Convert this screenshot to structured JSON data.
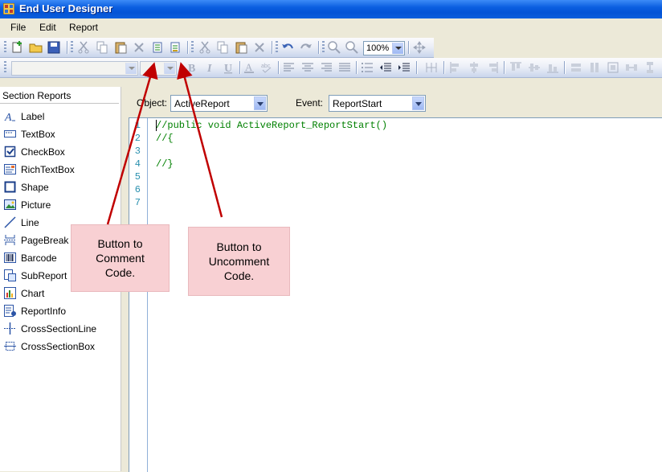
{
  "window": {
    "title": "End User Designer"
  },
  "menu": {
    "items": [
      "File",
      "Edit",
      "Report"
    ]
  },
  "toolbar1": {
    "zoom_value": "100%"
  },
  "toolbox": {
    "header": "Section Reports",
    "items": [
      {
        "label": "Label",
        "icon": "label-icon"
      },
      {
        "label": "TextBox",
        "icon": "textbox-icon"
      },
      {
        "label": "CheckBox",
        "icon": "checkbox-icon"
      },
      {
        "label": "RichTextBox",
        "icon": "richtextbox-icon"
      },
      {
        "label": "Shape",
        "icon": "shape-icon"
      },
      {
        "label": "Picture",
        "icon": "picture-icon"
      },
      {
        "label": "Line",
        "icon": "line-icon"
      },
      {
        "label": "PageBreak",
        "icon": "pagebreak-icon"
      },
      {
        "label": "Barcode",
        "icon": "barcode-icon"
      },
      {
        "label": "SubReport",
        "icon": "subreport-icon"
      },
      {
        "label": "Chart",
        "icon": "chart-icon"
      },
      {
        "label": "ReportInfo",
        "icon": "reportinfo-icon"
      },
      {
        "label": "CrossSectionLine",
        "icon": "crosssectionline-icon"
      },
      {
        "label": "CrossSectionBox",
        "icon": "crosssectionbox-icon"
      }
    ]
  },
  "script_editor": {
    "object_label": "Object:",
    "object_value": "ActiveReport",
    "event_label": "Event:",
    "event_value": "ReportStart",
    "line_numbers": [
      "1",
      "2",
      "3",
      "4",
      "5",
      "6",
      "7"
    ],
    "code_lines": [
      "//public void ActiveReport_ReportStart()",
      "//{",
      "",
      "//}",
      "",
      "",
      ""
    ]
  },
  "annotations": {
    "comment": "Button to\nComment\nCode.",
    "uncomment": "Button to\nUncomment\nCode."
  },
  "colors": {
    "titlebar": "#0453d6",
    "code_comment": "#008000",
    "line_number": "#2b91af",
    "callout_fill": "#f8d0d3",
    "arrow": "#c00000"
  }
}
